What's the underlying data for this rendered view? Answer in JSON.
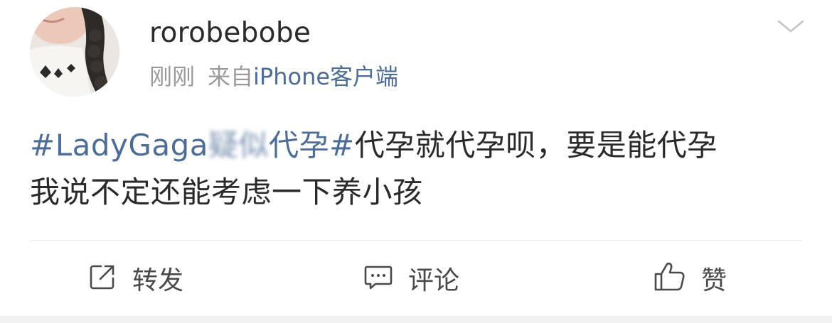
{
  "post": {
    "author": {
      "username": "rorobebobe"
    },
    "meta": {
      "time": "刚刚",
      "from_prefix": "来自",
      "client": "iPhone客户端"
    },
    "content": {
      "topic_start": "#LadyGaga",
      "topic_blurred": "疑似",
      "topic_end": "代孕#",
      "line1_rest": "代孕就代孕呗，要是能代孕",
      "line2": "我说不定还能考虑一下养小孩"
    },
    "actions": {
      "repost_label": "转发",
      "comment_label": "评论",
      "like_label": "赞"
    }
  },
  "colors": {
    "link": "#4e6d96",
    "text": "#2a2a2a",
    "meta": "#9a9a9a",
    "divider": "#ececec"
  },
  "icons": {
    "more": "chevron-down-icon",
    "repost": "repost-icon",
    "comment": "comment-icon",
    "like": "thumbs-up-icon"
  }
}
